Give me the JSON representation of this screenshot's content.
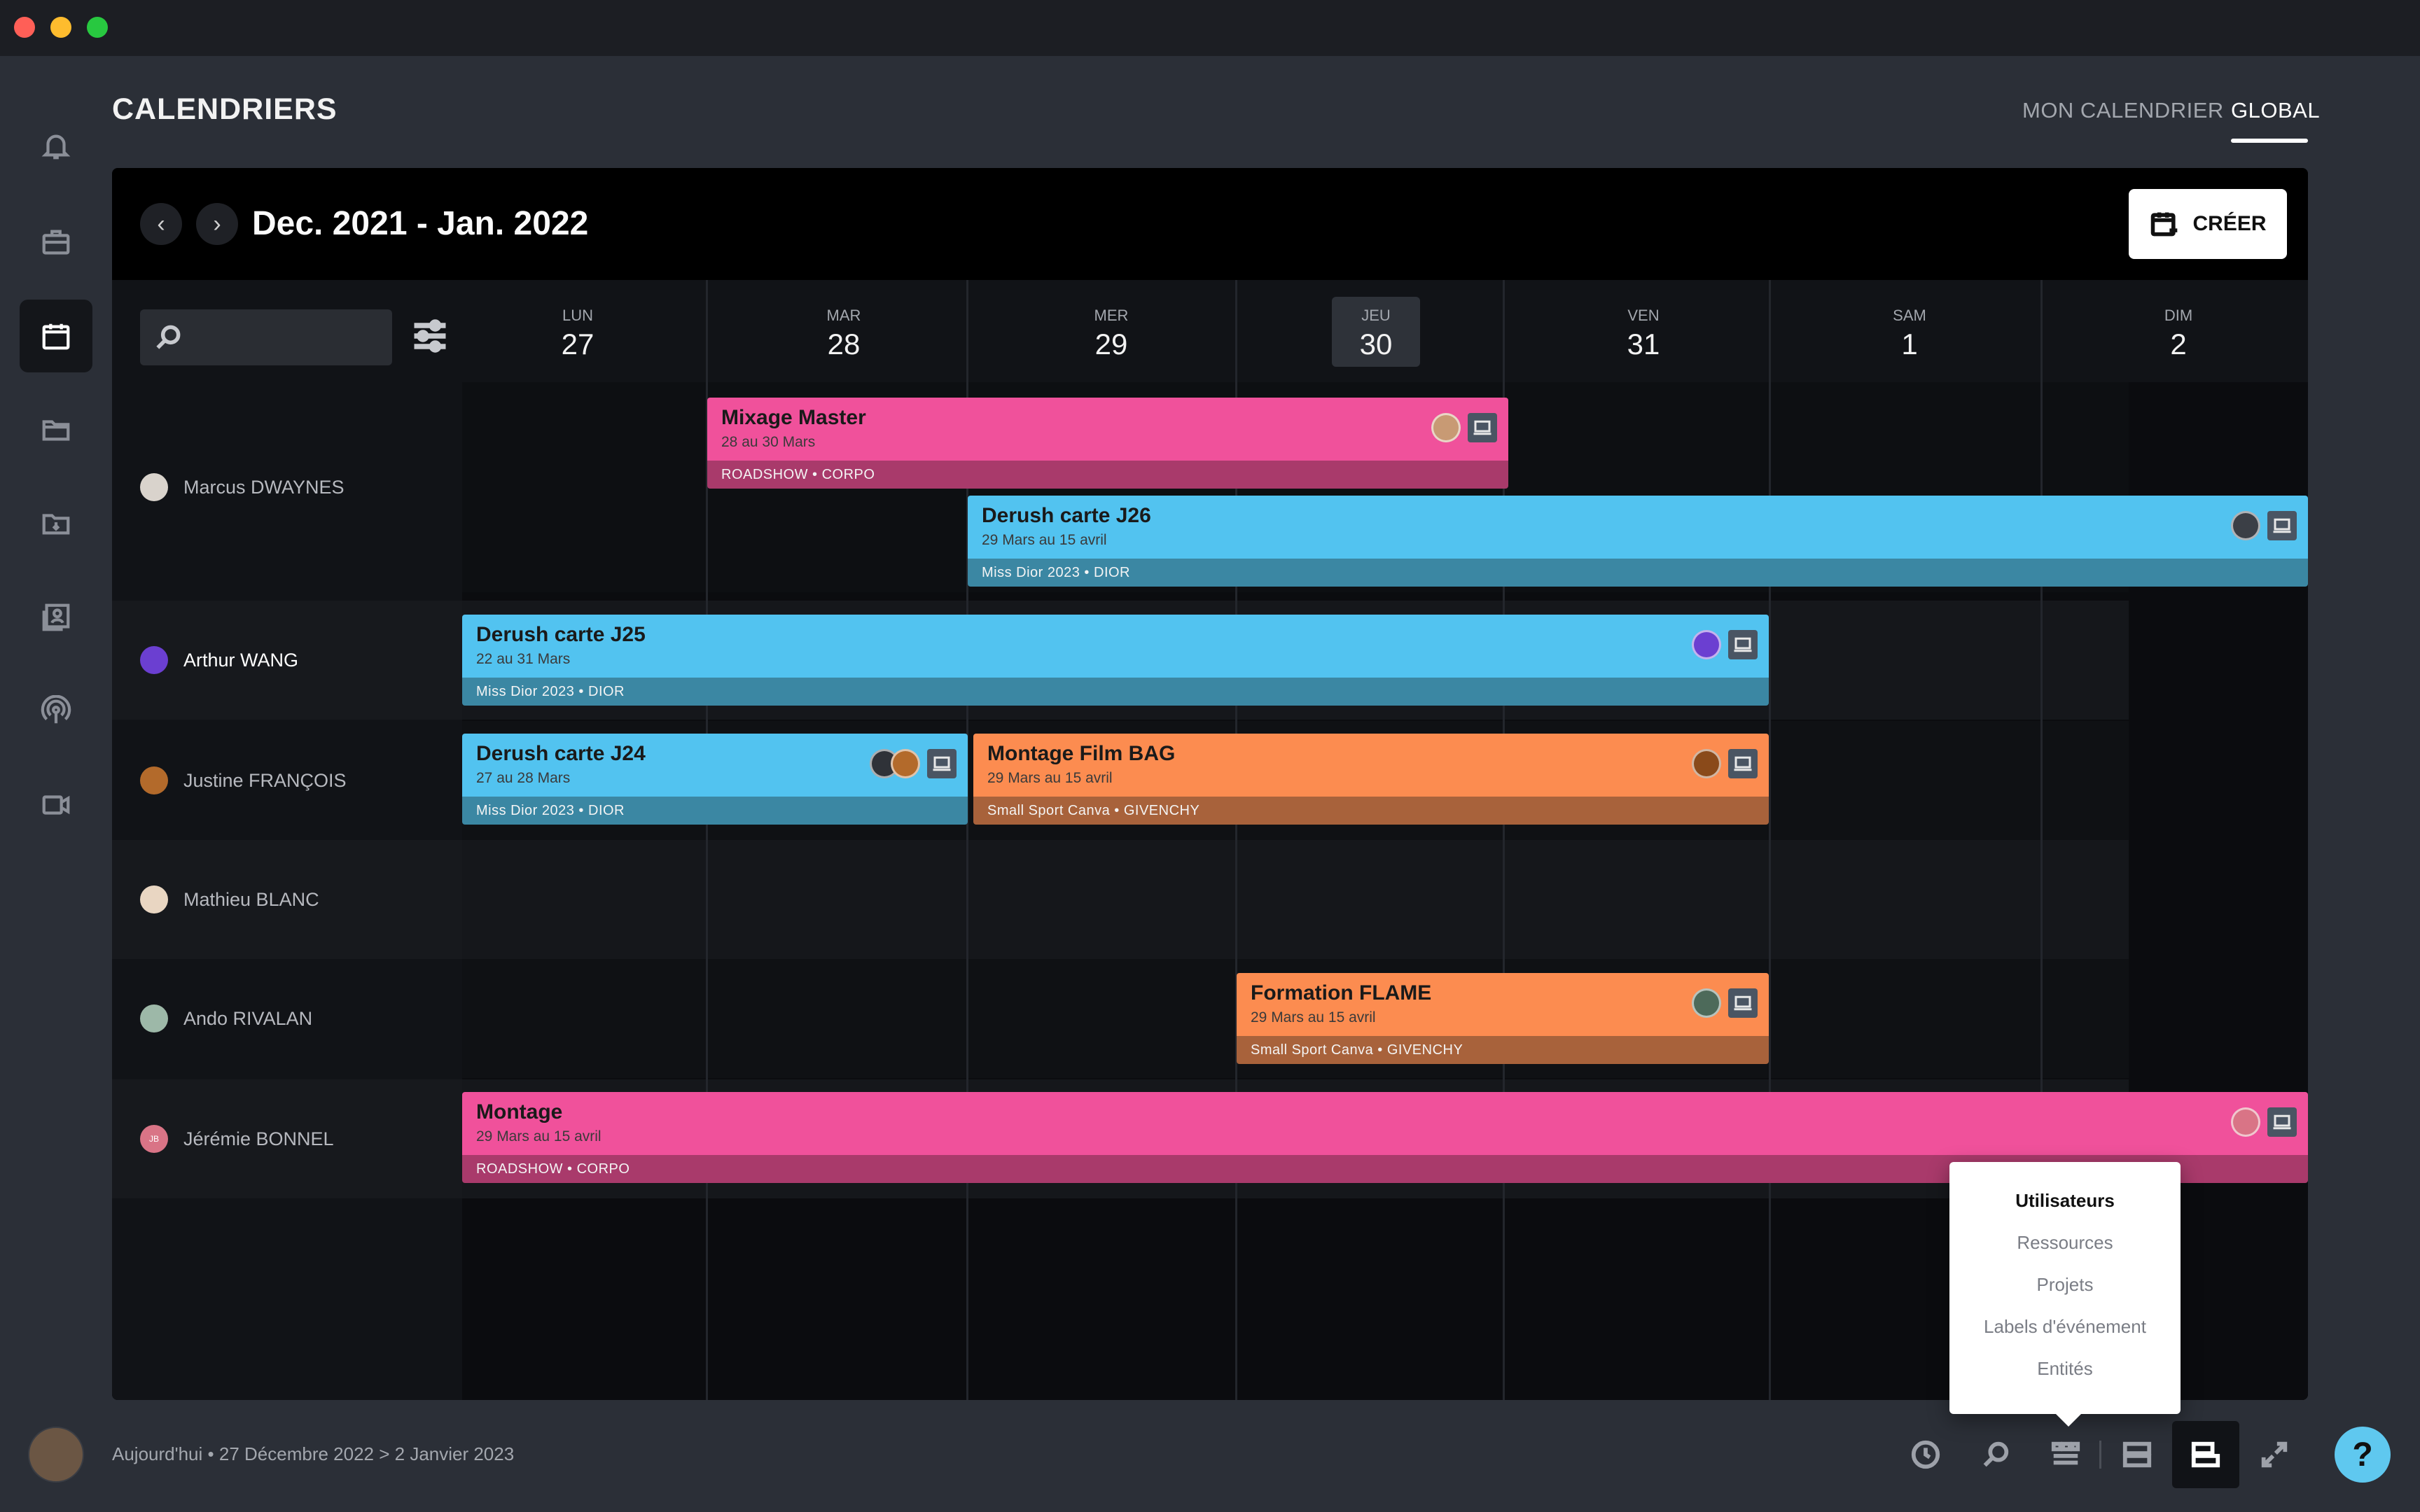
{
  "window": {
    "traffic_lights": [
      "close",
      "minimize",
      "zoom"
    ]
  },
  "sidebar": {
    "items": [
      {
        "icon": "bell-icon"
      },
      {
        "icon": "briefcase-icon"
      },
      {
        "icon": "calendar-icon",
        "active": true
      },
      {
        "icon": "folder-icon"
      },
      {
        "icon": "folder-download-icon"
      },
      {
        "icon": "contacts-icon"
      },
      {
        "icon": "broadcast-icon"
      },
      {
        "icon": "video-camera-icon"
      }
    ]
  },
  "header": {
    "title": "CALENDRIERS",
    "tabs": [
      {
        "label": "MON CALENDRIER",
        "active": false
      },
      {
        "label": "GLOBAL",
        "active": true
      }
    ]
  },
  "calendar": {
    "range_label": "Dec. 2021 - Jan. 2022",
    "create_label": "CRÉER",
    "days": [
      {
        "dow": "LUN",
        "num": "27",
        "today": false
      },
      {
        "dow": "MAR",
        "num": "28",
        "today": false
      },
      {
        "dow": "MER",
        "num": "29",
        "today": false
      },
      {
        "dow": "JEU",
        "num": "30",
        "today": true
      },
      {
        "dow": "VEN",
        "num": "31",
        "today": false
      },
      {
        "dow": "SAM",
        "num": "1",
        "today": false
      },
      {
        "dow": "DIM",
        "num": "2",
        "today": false
      }
    ],
    "users": [
      {
        "name": "Marcus DWAYNES",
        "avatar_color": "#d9d3cc",
        "bold": false
      },
      {
        "name": "Arthur WANG",
        "avatar_color": "#6b3fd1",
        "bold": true
      },
      {
        "name": "Justine FRANÇOIS",
        "avatar_color": "#b36a2b",
        "bold": false
      },
      {
        "name": "Mathieu BLANC",
        "avatar_color": "#e9d6c2",
        "bold": false
      },
      {
        "name": "Ando RIVALAN",
        "avatar_color": "#9db8a8",
        "bold": false
      },
      {
        "name": "Jérémie BONNEL",
        "avatar_color": "#d97486",
        "initials": "JB",
        "bold": false
      }
    ],
    "events": [
      {
        "title": "Mixage Master",
        "dates": "28 au 30 Mars",
        "tags": "ROADSHOW  •  CORPO",
        "color": "pink"
      },
      {
        "title": "Derush carte J26",
        "dates": "29 Mars au 15 avril",
        "tags": "Miss Dior 2023  •  DIOR",
        "color": "blue"
      },
      {
        "title": "Derush carte J25",
        "dates": "22 au 31 Mars",
        "tags": "Miss Dior 2023  •  DIOR",
        "color": "blue"
      },
      {
        "title": "Derush carte J24",
        "dates": "27 au 28 Mars",
        "tags": "Miss Dior 2023  •  DIOR",
        "color": "blue"
      },
      {
        "title": "Montage Film BAG",
        "dates": "29 Mars au 15 avril",
        "tags": "Small Sport Canva  •  GIVENCHY",
        "color": "orange"
      },
      {
        "title": "Formation FLAME",
        "dates": "29 Mars au 15 avril",
        "tags": "Small Sport Canva  •  GIVENCHY",
        "color": "orange"
      },
      {
        "title": "Montage",
        "dates": "29 Mars au 15 avril",
        "tags": "ROADSHOW  •  CORPO",
        "color": "pink"
      }
    ]
  },
  "group_menu": {
    "items": [
      {
        "label": "Utilisateurs",
        "active": true
      },
      {
        "label": "Ressources",
        "active": false
      },
      {
        "label": "Projets",
        "active": false
      },
      {
        "label": "Labels d'événement",
        "active": false
      },
      {
        "label": "Entités",
        "active": false
      }
    ]
  },
  "footer": {
    "today_label": "Aujourd'hui",
    "separator": "•",
    "date_range": "27 Décembre 2022 > 2 Janvier 2023",
    "help_label": "?"
  },
  "colors": {
    "pink": "#f0519b",
    "blue": "#52c3f0",
    "orange": "#fc8c50",
    "help": "#5fc8ef"
  }
}
